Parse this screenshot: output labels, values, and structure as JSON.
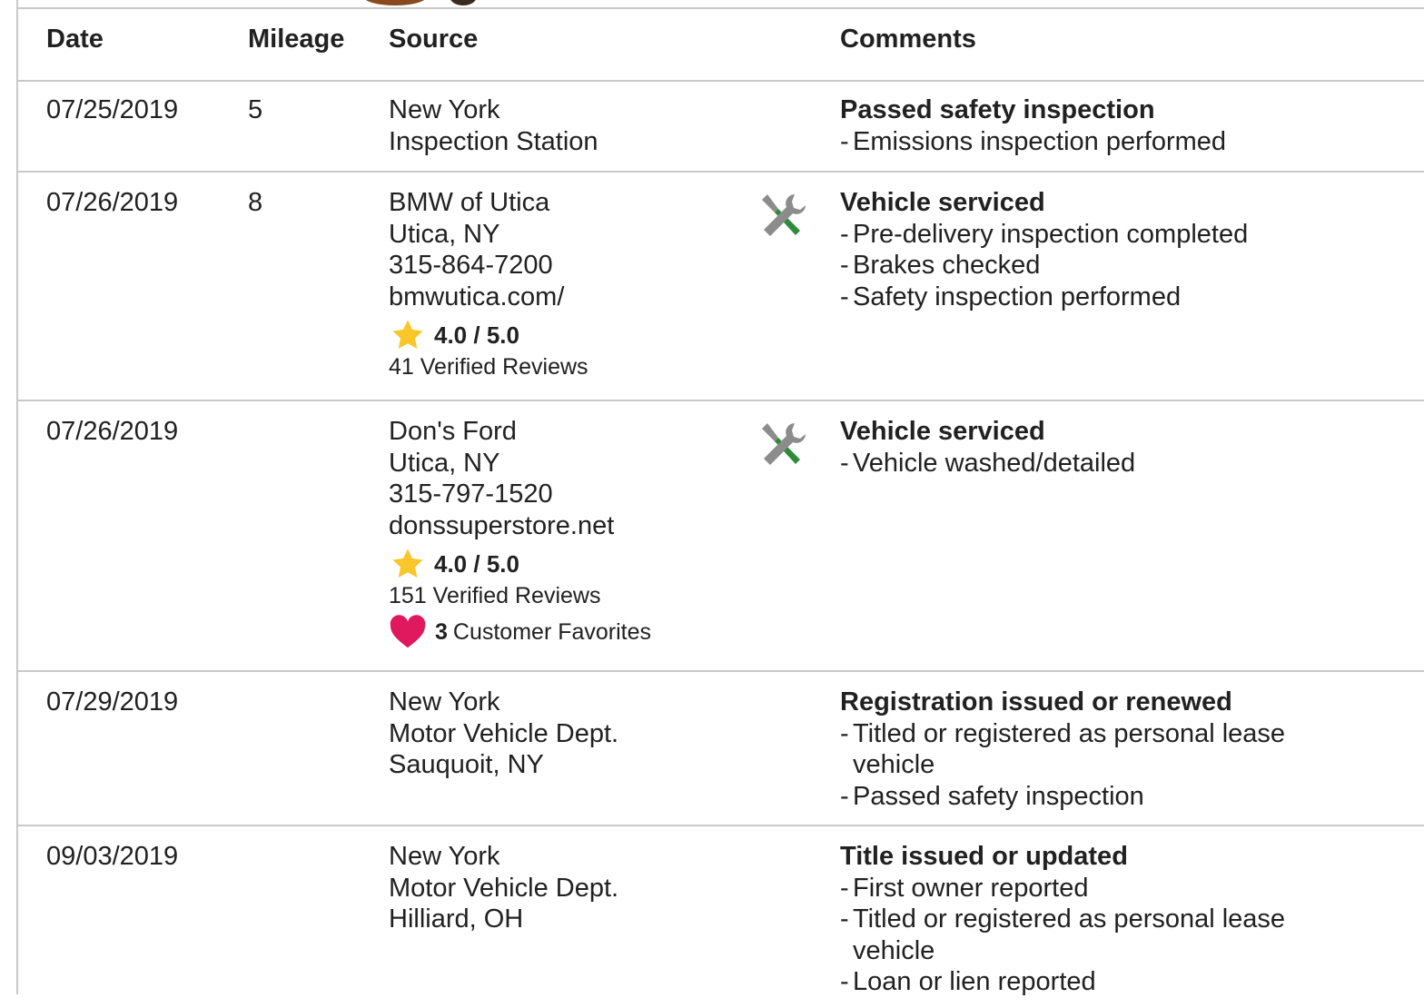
{
  "colors": {
    "star": "#f9c72a",
    "heart": "#e0195f",
    "wrench_handle": "#2e8b3a",
    "tool_gray": "#8c8c8c",
    "divider": "#c9c9c9"
  },
  "header": {
    "date": "Date",
    "mileage": "Mileage",
    "source": "Source",
    "comments": "Comments"
  },
  "rows": [
    {
      "date": "07/25/2019",
      "mileage": "5",
      "source": [
        "New York",
        "Inspection Station"
      ],
      "title": "Passed safety inspection",
      "items": [
        "Emissions inspection performed"
      ]
    },
    {
      "date": "07/26/2019",
      "mileage": "8",
      "source": [
        "BMW of Utica",
        "Utica, NY",
        "315-864-7200",
        "bmwutica.com/"
      ],
      "rating": "4.0 / 5.0",
      "reviews": "41 Verified Reviews",
      "icon": "service-tools-icon",
      "title": "Vehicle serviced",
      "items": [
        "Pre-delivery inspection completed",
        "Brakes checked",
        "Safety inspection performed"
      ]
    },
    {
      "date": "07/26/2019",
      "mileage": "",
      "source": [
        "Don's Ford",
        "Utica, NY",
        "315-797-1520",
        "donssuperstore.net"
      ],
      "rating": "4.0 / 5.0",
      "reviews": "151 Verified Reviews",
      "favorites_count": "3",
      "favorites_label": "Customer Favorites",
      "icon": "service-tools-icon",
      "title": "Vehicle serviced",
      "items": [
        "Vehicle washed/detailed"
      ]
    },
    {
      "date": "07/29/2019",
      "mileage": "",
      "source": [
        "New York",
        "Motor Vehicle Dept.",
        "Sauquoit, NY"
      ],
      "title": "Registration issued or renewed",
      "items": [
        "Titled or registered as personal lease vehicle",
        "Passed safety inspection"
      ]
    },
    {
      "date": "09/03/2019",
      "mileage": "",
      "source": [
        "New York",
        "Motor Vehicle Dept.",
        "Hilliard, OH"
      ],
      "title": "Title issued or updated",
      "items": [
        "First owner reported",
        "Titled or registered as personal lease vehicle",
        "Loan or lien reported"
      ]
    }
  ]
}
